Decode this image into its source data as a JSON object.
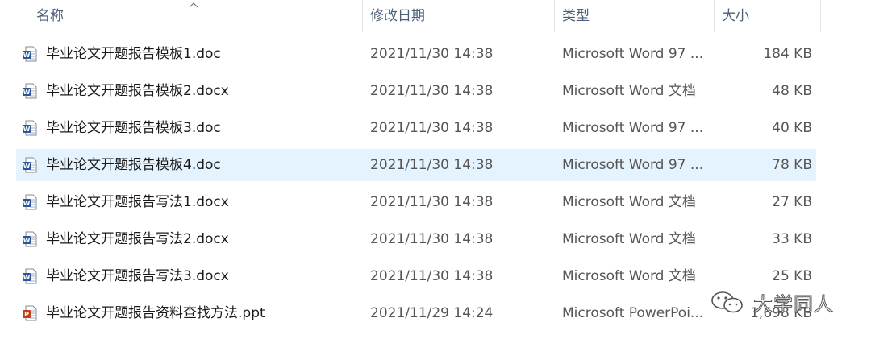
{
  "columns": {
    "name": "名称",
    "date": "修改日期",
    "type": "类型",
    "size": "大小"
  },
  "files": [
    {
      "name": "毕业论文开题报告模板1.doc",
      "date": "2021/11/30 14:38",
      "type": "Microsoft Word 97 ...",
      "size": "184 KB",
      "icon": "word-doc-icon"
    },
    {
      "name": "毕业论文开题报告模板2.docx",
      "date": "2021/11/30 14:38",
      "type": "Microsoft Word 文档",
      "size": "48 KB",
      "icon": "word-docx-icon"
    },
    {
      "name": "毕业论文开题报告模板3.doc",
      "date": "2021/11/30 14:38",
      "type": "Microsoft Word 97 ...",
      "size": "40 KB",
      "icon": "word-doc-icon"
    },
    {
      "name": "毕业论文开题报告模板4.doc",
      "date": "2021/11/30 14:38",
      "type": "Microsoft Word 97 ...",
      "size": "78 KB",
      "icon": "word-doc-icon",
      "selected": true
    },
    {
      "name": "毕业论文开题报告写法1.docx",
      "date": "2021/11/30 14:38",
      "type": "Microsoft Word 文档",
      "size": "27 KB",
      "icon": "word-docx-icon"
    },
    {
      "name": "毕业论文开题报告写法2.docx",
      "date": "2021/11/30 14:38",
      "type": "Microsoft Word 文档",
      "size": "33 KB",
      "icon": "word-docx-icon"
    },
    {
      "name": "毕业论文开题报告写法3.docx",
      "date": "2021/11/30 14:38",
      "type": "Microsoft Word 文档",
      "size": "25 KB",
      "icon": "word-docx-icon"
    },
    {
      "name": "毕业论文开题报告资料查找方法.ppt",
      "date": "2021/11/29 14:24",
      "type": "Microsoft PowerPoi...",
      "size": "1,698 KB",
      "icon": "powerpoint-icon"
    }
  ],
  "watermark": {
    "text": "大学同人",
    "icon": "wechat-icon"
  },
  "colors": {
    "header_text": "#4c607a",
    "selected_row": "#e5f3ff",
    "word_blue": "#2b579a",
    "ppt_orange": "#c43e1c"
  }
}
